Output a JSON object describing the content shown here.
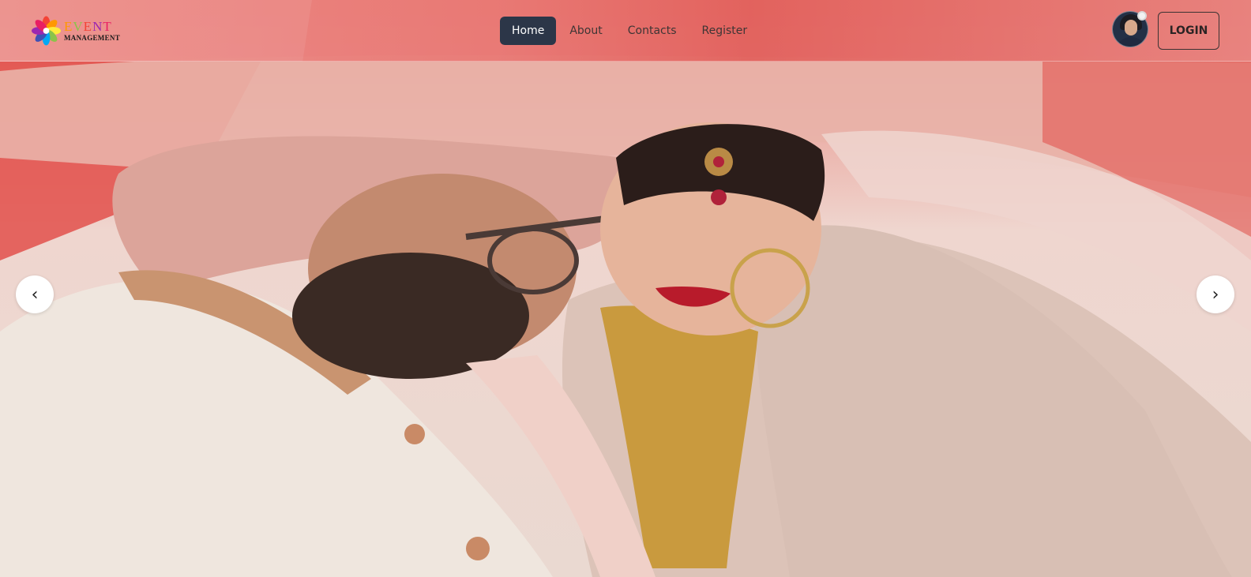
{
  "logo": {
    "top_letters": [
      "E",
      "V",
      "E",
      "N",
      "T"
    ],
    "bottom": "MANAGEMENT"
  },
  "nav": {
    "items": [
      {
        "label": "Home",
        "active": true
      },
      {
        "label": "About",
        "active": false
      },
      {
        "label": "Contacts",
        "active": false
      },
      {
        "label": "Register",
        "active": false
      }
    ]
  },
  "header": {
    "login_label": "LOGIN"
  },
  "carousel": {
    "prev_label": "‹",
    "next_label": "›"
  },
  "colors": {
    "header": "#e9787a",
    "nav_active": "#2c3648",
    "button_border": "#3b3333"
  },
  "icons": {
    "logo": "flower-logo-icon",
    "avatar": "user-avatar",
    "prev": "chevron-left-icon",
    "next": "chevron-right-icon"
  }
}
